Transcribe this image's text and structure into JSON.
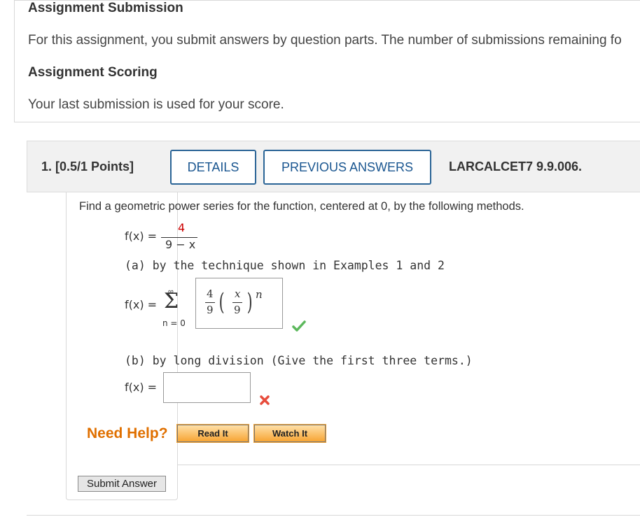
{
  "submission": {
    "heading": "Assignment Submission",
    "text": "For this assignment, you submit answers by question parts. The number of submissions remaining fo",
    "scoring_heading": "Assignment Scoring",
    "scoring_text": "Your last submission is used for your score."
  },
  "question": {
    "number_points": "1.  [0.5/1 Points]",
    "details_label": "DETAILS",
    "previous_answers_label": "PREVIOUS ANSWERS",
    "reference": "LARCALCET7 9.9.006.",
    "prompt": "Find a geometric power series for the function, centered at 0, by the following methods.",
    "function": {
      "lhs": "f(x)  =",
      "numerator": "4",
      "denominator": "9 − x"
    },
    "part_a": {
      "label": "(a) by the technique shown in Examples 1 and 2",
      "lhs": "f(x)  =",
      "sum_upper": "∞",
      "sum_symbol": "Σ",
      "sum_lower": "n = 0",
      "answer": {
        "coef_num": "4",
        "coef_den": "9",
        "inner_num": "x",
        "inner_den": "9",
        "exponent": "n"
      },
      "status": "correct"
    },
    "part_b": {
      "label": "(b) by long division (Give the first three terms.)",
      "lhs": "f(x)  =",
      "answer_value": "",
      "status": "incorrect"
    },
    "need_help_label": "Need Help?",
    "read_it_label": "Read It",
    "watch_it_label": "Watch It",
    "submit_label": "Submit Answer"
  },
  "colors": {
    "accent_blue": "#2a6496",
    "help_orange": "#e07000",
    "correct_green": "#5cb85c",
    "incorrect_red": "#e74c3c",
    "numerator_red": "#cc0000"
  }
}
